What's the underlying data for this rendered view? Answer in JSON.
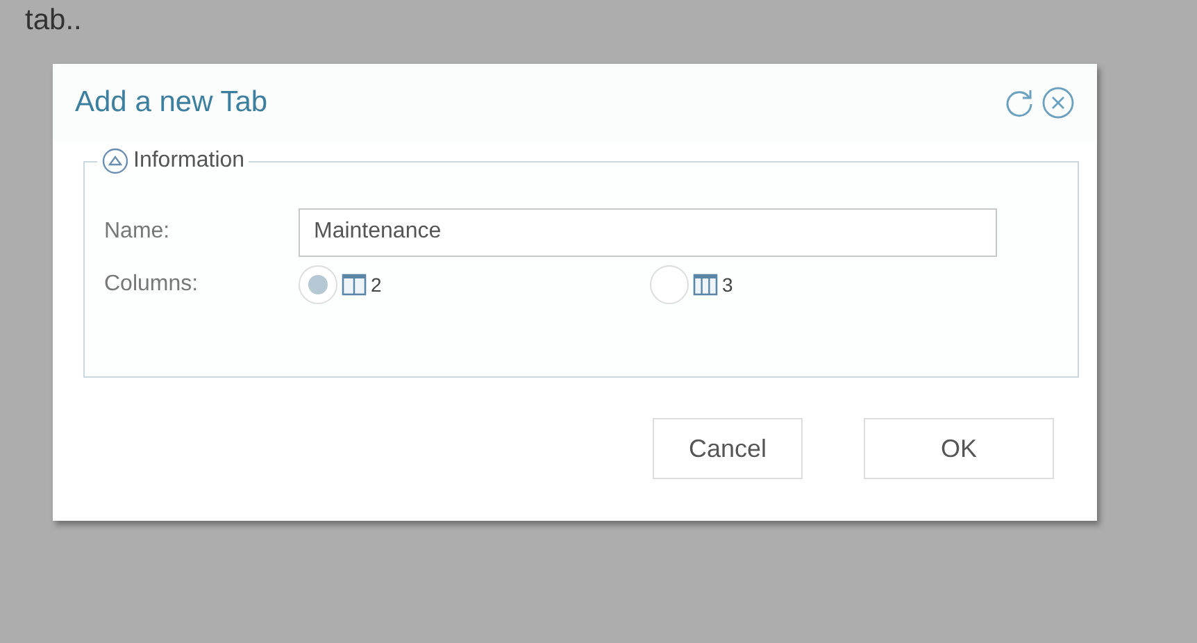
{
  "background_text": "tab..",
  "dialog": {
    "title": "Add a new Tab",
    "section": {
      "legend": "Information",
      "expanded": true
    },
    "name_field": {
      "label": "Name:",
      "value": "Maintenance"
    },
    "columns_field": {
      "label": "Columns:",
      "options": [
        {
          "label": "2",
          "kind": "double",
          "selected": true
        },
        {
          "label": "3",
          "kind": "triple",
          "selected": false
        }
      ]
    },
    "buttons": [
      "Cancel",
      "OK"
    ]
  }
}
